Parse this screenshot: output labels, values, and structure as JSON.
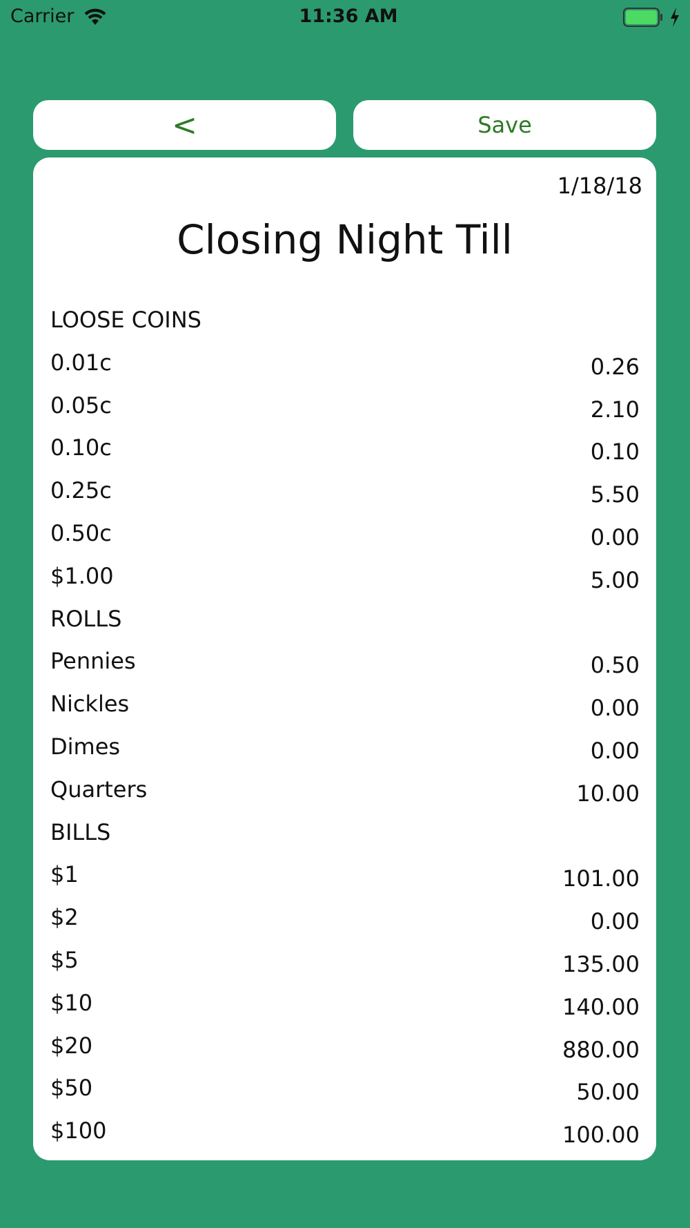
{
  "status_bar": {
    "carrier": "Carrier",
    "time": "11:36 AM",
    "wifi_icon": "wifi-icon",
    "battery_icon": "battery-icon",
    "charging_icon": "charging-bolt-icon",
    "battery_color": "#4cd964"
  },
  "toolbar": {
    "back_label": "<",
    "save_label": "Save",
    "accent_color": "#2c7a24"
  },
  "sheet": {
    "date": "1/18/18",
    "title": "Closing Night Till",
    "sections": [
      {
        "heading": "LOOSE COINS",
        "rows": [
          {
            "label": "0.01c",
            "value": "0.26"
          },
          {
            "label": "0.05c",
            "value": "2.10"
          },
          {
            "label": "0.10c",
            "value": "0.10"
          },
          {
            "label": "0.25c",
            "value": "5.50"
          },
          {
            "label": "0.50c",
            "value": "0.00"
          },
          {
            "label": "$1.00",
            "value": "5.00"
          }
        ]
      },
      {
        "heading": "ROLLS",
        "rows": [
          {
            "label": "Pennies",
            "value": "0.50"
          },
          {
            "label": "Nickles",
            "value": "0.00"
          },
          {
            "label": "Dimes",
            "value": "0.00"
          },
          {
            "label": "Quarters",
            "value": "10.00"
          }
        ]
      },
      {
        "heading": "BILLS",
        "rows": [
          {
            "label": "$1",
            "value": "101.00"
          },
          {
            "label": "$2",
            "value": "0.00"
          },
          {
            "label": "$5",
            "value": "135.00"
          },
          {
            "label": "$10",
            "value": "140.00"
          },
          {
            "label": "$20",
            "value": "880.00"
          },
          {
            "label": "$50",
            "value": "50.00"
          },
          {
            "label": "$100",
            "value": "100.00"
          }
        ]
      }
    ]
  },
  "colors": {
    "background": "#2c9a6f",
    "card": "#ffffff"
  }
}
